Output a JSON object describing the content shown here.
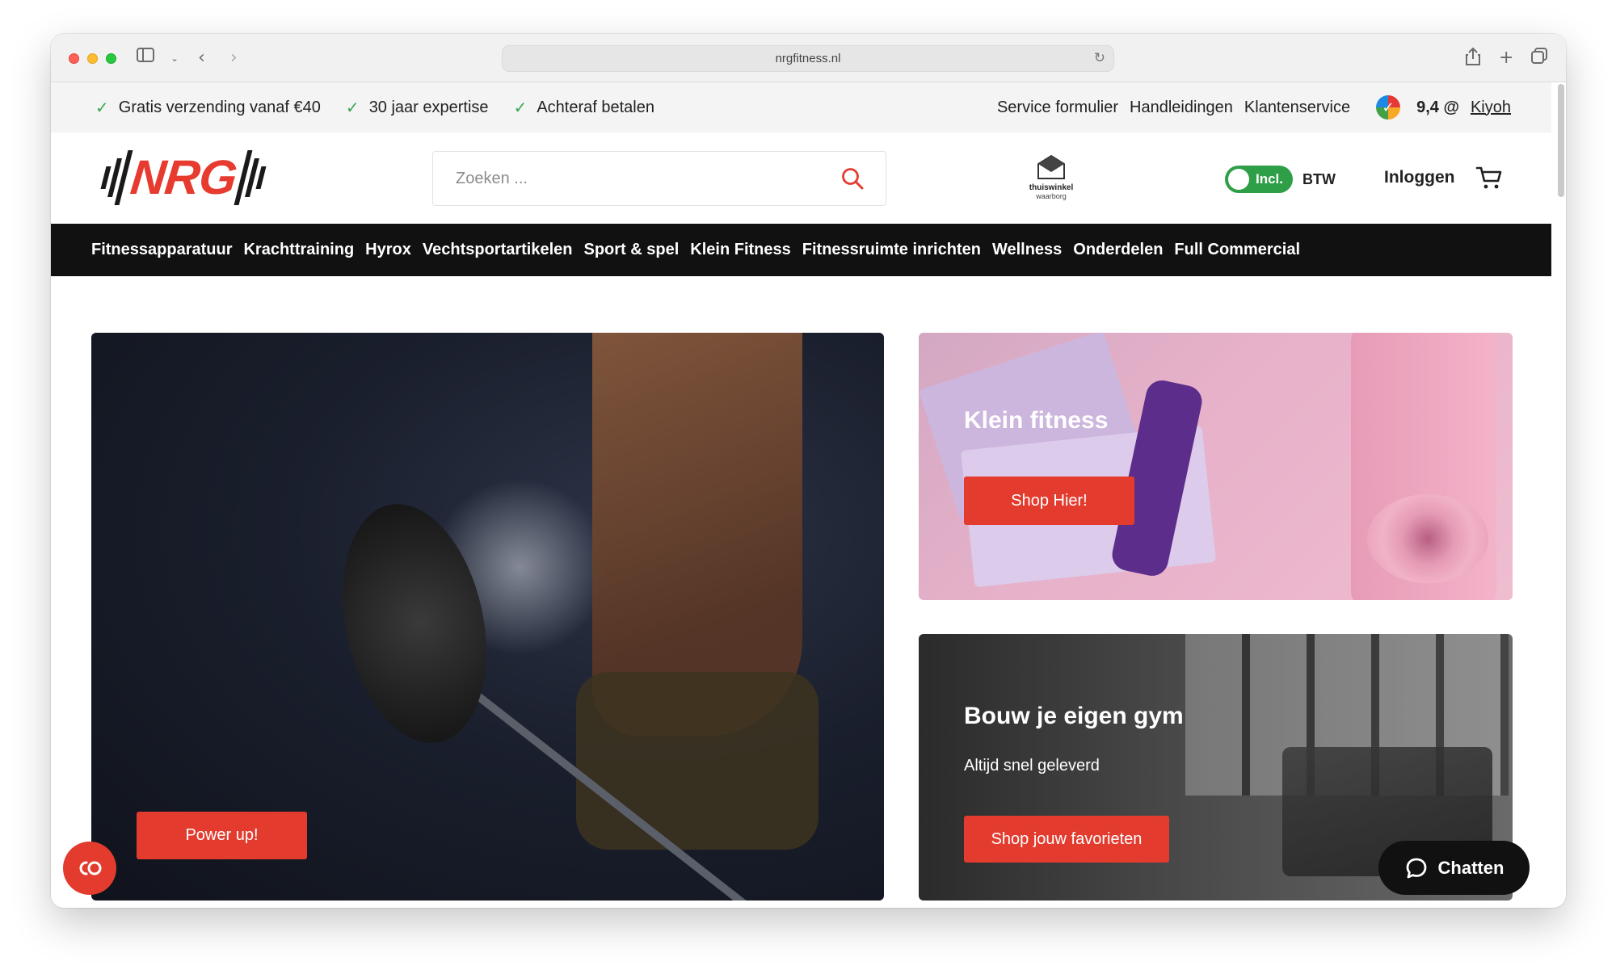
{
  "browser": {
    "url": "nrgfitness.nl"
  },
  "usp": [
    {
      "label": "Gratis verzending vanaf €40"
    },
    {
      "label": "30 jaar expertise"
    },
    {
      "label": "Achteraf betalen"
    }
  ],
  "top_links": [
    {
      "label": "Service formulier"
    },
    {
      "label": "Handleidingen"
    },
    {
      "label": "Klantenservice"
    }
  ],
  "kiyoh": {
    "rating": "9,4 @",
    "link": "Kiyoh"
  },
  "header": {
    "logo": "NRG",
    "search_placeholder": "Zoeken ...",
    "thuiswinkel_title": "thuiswinkel",
    "thuiswinkel_sub": "waarborg",
    "btw_toggle": "Incl.",
    "btw_label": "BTW",
    "login": "Inloggen"
  },
  "nav": [
    {
      "label": "Fitnessapparatuur"
    },
    {
      "label": "Krachttraining"
    },
    {
      "label": "Hyrox"
    },
    {
      "label": "Vechtsportartikelen"
    },
    {
      "label": "Sport & spel"
    },
    {
      "label": "Klein Fitness"
    },
    {
      "label": "Fitnessruimte inrichten"
    },
    {
      "label": "Wellness"
    },
    {
      "label": "Onderdelen"
    },
    {
      "label": "Full Commercial"
    }
  ],
  "hero": {
    "button": "Power up!"
  },
  "card_klein": {
    "title": "Klein fitness",
    "button": "Shop Hier!"
  },
  "card_gym": {
    "title": "Bouw je eigen gym",
    "subtitle": "Altijd snel geleverd",
    "button": "Shop jouw favorieten"
  },
  "chat": {
    "label": "Chatten"
  },
  "colors": {
    "accent": "#e33c2f",
    "nav_bg": "#111111",
    "toggle": "#2e9e47",
    "check": "#3aa655"
  }
}
